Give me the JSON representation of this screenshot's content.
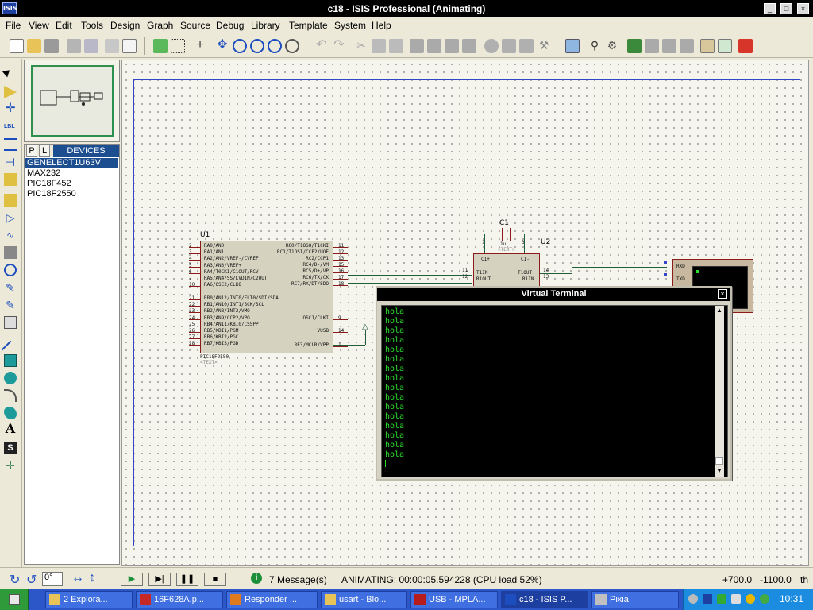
{
  "window": {
    "title": "c18 - ISIS Professional (Animating)",
    "app_icon_text": "ISIS"
  },
  "menu": [
    "File",
    "View",
    "Edit",
    "Tools",
    "Design",
    "Graph",
    "Source",
    "Debug",
    "Library",
    "Template",
    "System",
    "Help"
  ],
  "device_panel": {
    "tab_p": "P",
    "tab_l": "L",
    "header": "DEVICES",
    "items": [
      "GENELECT1U63V",
      "MAX232",
      "PIC18F452",
      "PIC18F2550"
    ],
    "selected_index": 0
  },
  "schematic": {
    "u1": {
      "ref": "U1",
      "part": "PIC18F2550",
      "text": "<TEXT>",
      "left_pins": [
        {
          "num": "2",
          "name": "RA0/AN0"
        },
        {
          "num": "3",
          "name": "RA1/AN1"
        },
        {
          "num": "4",
          "name": "RA2/AN2/VREF-/CVREF"
        },
        {
          "num": "5",
          "name": "RA3/AN3/VREF+"
        },
        {
          "num": "6",
          "name": "RA4/T0CKI/C1OUT/RCV"
        },
        {
          "num": "7",
          "name": "RA5/AN4/SS/LVDIN/C2OUT"
        },
        {
          "num": "10",
          "name": "RA6/OSC2/CLKO"
        },
        {
          "num": "21",
          "name": "RB0/AN12/INT0/FLT0/SDI/SDA"
        },
        {
          "num": "22",
          "name": "RB1/AN10/INT1/SCK/SCL"
        },
        {
          "num": "23",
          "name": "RB2/AN8/INT2/VMO"
        },
        {
          "num": "24",
          "name": "RB3/AN9/CCP2/VPO"
        },
        {
          "num": "25",
          "name": "RB4/AN11/KBI0/CSSPP"
        },
        {
          "num": "26",
          "name": "RB5/KBI1/PGM"
        },
        {
          "num": "27",
          "name": "RB6/KBI2/PGC"
        },
        {
          "num": "28",
          "name": "RB7/KBI3/PGD"
        }
      ],
      "right_pins": [
        {
          "num": "11",
          "name": "RC0/T1OSO/T1CKI"
        },
        {
          "num": "12",
          "name": "RC1/T1OSI/CCP2/UOE"
        },
        {
          "num": "13",
          "name": "RC2/CCP1"
        },
        {
          "num": "15",
          "name": "RC4/D-/VM"
        },
        {
          "num": "16",
          "name": "RC5/D+/VP"
        },
        {
          "num": "17",
          "name": "RC6/TX/CK"
        },
        {
          "num": "18",
          "name": "RC7/RX/DT/SDO"
        },
        {
          "num": "9",
          "name": "OSC1/CLKI"
        },
        {
          "num": "14",
          "name": "VUSB"
        },
        {
          "num": "1",
          "name": "RE3/MCLR/VPP"
        }
      ]
    },
    "u2": {
      "ref": "U2",
      "pins_top": [
        "C1+",
        "C1-"
      ],
      "left_pins": [
        {
          "num": "11",
          "name": "T1IN"
        },
        {
          "num": "12",
          "name": "R1OUT"
        }
      ],
      "right_pins": [
        {
          "num": "14",
          "name": "T1OUT"
        },
        {
          "num": "13",
          "name": "R1IN"
        }
      ]
    },
    "c1": {
      "ref": "C1",
      "value": "1u",
      "text": "<TEXT>",
      "pin_left": "1",
      "pin_right": "3"
    },
    "terminal_device": {
      "rxd": "RXD",
      "txd": "TXD"
    }
  },
  "virtual_terminal": {
    "title": "Virtual Terminal",
    "close": "×",
    "lines": [
      "hola",
      "hola",
      "hola",
      "hola",
      "hola",
      "hola",
      "hola",
      "hola",
      "hola",
      "hola",
      "hola",
      "hola",
      "hola",
      "hola",
      "hola",
      "hola"
    ]
  },
  "status": {
    "rotation": "0°",
    "messages": "7 Message(s)",
    "animating": "ANIMATING: 00:00:05.594228 (CPU load 52%)",
    "coord_x": "+700.0",
    "coord_y": "-1100.0",
    "unit": "th"
  },
  "taskbar": {
    "tasks": [
      {
        "label": "2 Explora...",
        "active": false
      },
      {
        "label": "16F628A.p...",
        "active": false
      },
      {
        "label": "Responder ...",
        "active": false
      },
      {
        "label": "usart - Blo...",
        "active": false
      },
      {
        "label": "USB - MPLA...",
        "active": false
      },
      {
        "label": "c18 - ISIS P...",
        "active": true
      },
      {
        "label": "Pixia",
        "active": false
      }
    ],
    "clock": "10:31"
  }
}
